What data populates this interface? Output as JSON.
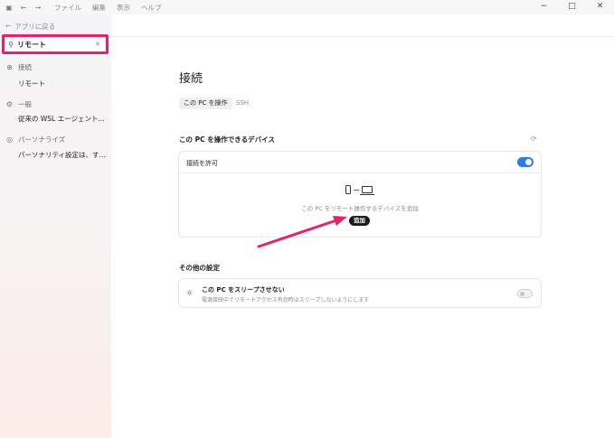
{
  "menubar": {
    "panel_icon": "sidebar-toggle-icon",
    "items": [
      "ファイル",
      "編集",
      "表示",
      "ヘルプ"
    ]
  },
  "window_controls": {
    "minimize": "−",
    "maximize": "□",
    "close": "✕"
  },
  "sidebar": {
    "back_label": "アプリに戻る",
    "search": {
      "value": "リモート"
    },
    "groups": [
      {
        "label": "接続",
        "icon": "globe-icon",
        "items": [
          "リモート"
        ]
      },
      {
        "label": "一般",
        "icon": "gear-icon",
        "items": [
          "従来の WSL エージェント..."
        ]
      },
      {
        "label": "パーソナライズ",
        "icon": "palette-icon",
        "items": [
          "パーソナリティ設定は、す..."
        ]
      }
    ]
  },
  "main": {
    "title": "接続",
    "tabs": [
      {
        "label": "この PC を操作",
        "active": true
      },
      {
        "label": "SSH",
        "active": false
      }
    ],
    "devices_section": {
      "title": "この PC を操作できるデバイス",
      "allow_label": "接続を許可",
      "allow_enabled": true,
      "empty_message": "この PC をリモート操作するデバイスを追加",
      "add_button": "追加"
    },
    "other_section": {
      "title": "その他の設定",
      "sleep_title": "この PC をスリープさせない",
      "sleep_subtitle": "電源接続中でリモートアクセス有効時はスリープしないようにします",
      "sleep_enabled": false
    }
  },
  "colors": {
    "highlight": "#e0246e",
    "toggle_on": "#2a7de1",
    "add_button": "#1a1a1a"
  }
}
